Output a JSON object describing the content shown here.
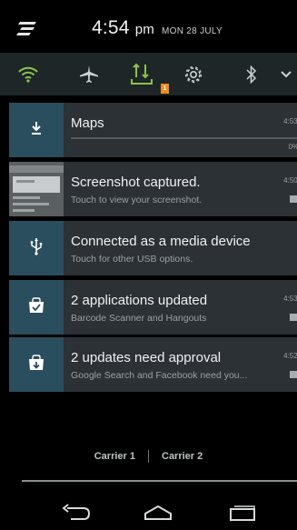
{
  "header": {
    "time": "4:54",
    "ampm": "pm",
    "date": "MON 28 JULY"
  },
  "quick_settings": {
    "tiles": [
      {
        "name": "wifi-icon",
        "color": "#8bc34a"
      },
      {
        "name": "airplane-icon",
        "color": "#cfd4d6"
      },
      {
        "name": "usb-tethering-icon",
        "color": "#8bc34a"
      },
      {
        "name": "settings-gear-icon",
        "color": "#cfd4d6"
      },
      {
        "name": "bluetooth-icon",
        "color": "#cfd4d6"
      },
      {
        "name": "chevron-down-icon",
        "color": "#cfd4d6"
      }
    ],
    "badge": "1"
  },
  "notifications": [
    {
      "title": "Maps",
      "subtitle": "",
      "time": "4:53 pm",
      "progress_label": "0%",
      "progress": 0,
      "icon": "download-icon"
    },
    {
      "title": "Screenshot captured.",
      "subtitle": "Touch to view your screenshot.",
      "time": "4:50 pm",
      "icon": "screenshot-thumbnail"
    },
    {
      "title": "Connected as a media device",
      "subtitle": "Touch for other USB options.",
      "time": "",
      "icon": "usb-icon"
    },
    {
      "title": "2 applications updated",
      "subtitle": "Barcode Scanner and Hangouts",
      "time": "4:53 pm",
      "icon": "store-bag-check-icon"
    },
    {
      "title": "2 updates need approval",
      "subtitle": "Google Search and Facebook need you...",
      "time": "4:52 pm",
      "icon": "store-bag-download-icon"
    }
  ],
  "carriers": [
    "Carrier 1",
    "Carrier 2"
  ],
  "colors": {
    "accent": "#8bc34a",
    "icon_box": "#2a4e5d",
    "card": "#2b3135",
    "badge": "#f08a24"
  }
}
